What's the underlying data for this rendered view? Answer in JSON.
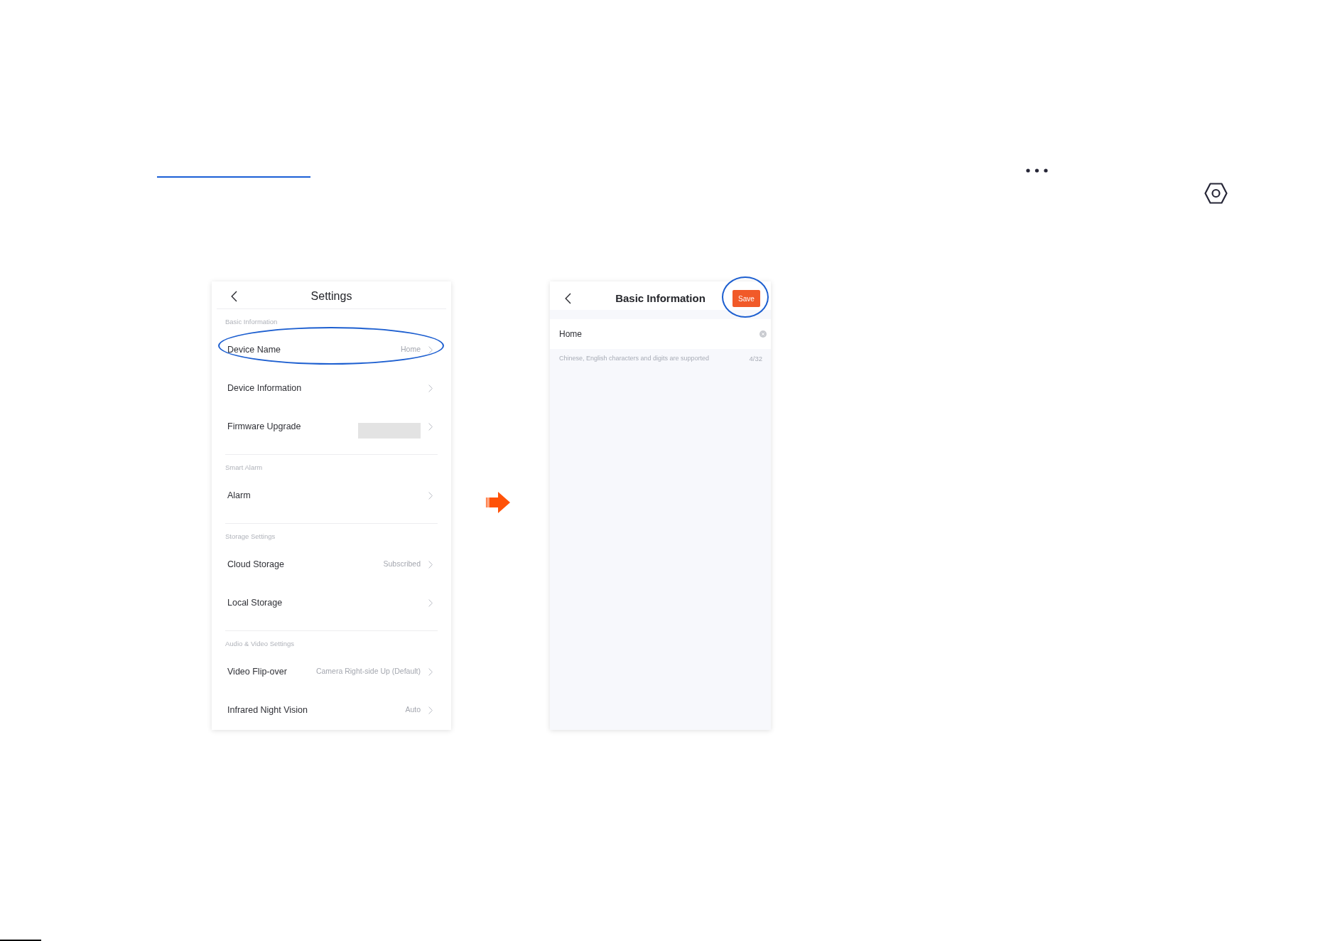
{
  "settings_screen": {
    "title": "Settings",
    "sections": [
      {
        "label": "Basic Information",
        "items": [
          {
            "label": "Device Name",
            "kind": "value",
            "value": "Home",
            "circled": true
          },
          {
            "label": "Device Information",
            "kind": "plain",
            "circled": false
          },
          {
            "label": "Firmware Upgrade",
            "kind": "masked",
            "circled": false
          }
        ]
      },
      {
        "label": "Smart Alarm",
        "items": [
          {
            "label": "Alarm",
            "kind": "plain",
            "circled": false
          }
        ]
      },
      {
        "label": "Storage Settings",
        "items": [
          {
            "label": "Cloud Storage",
            "kind": "value",
            "value": "Subscribed",
            "circled": false
          },
          {
            "label": "Local Storage",
            "kind": "plain",
            "circled": false
          }
        ]
      },
      {
        "label": "Audio & Video Settings",
        "items": [
          {
            "label": "Video Flip-over",
            "kind": "value",
            "value": "Camera Right-side Up (Default)",
            "circled": false
          },
          {
            "label": "Infrared Night Vision",
            "kind": "value",
            "value": "Auto",
            "circled": false
          }
        ]
      }
    ]
  },
  "basic_information_screen": {
    "title": "Basic Information",
    "save_button": {
      "label": "Save",
      "circled": true
    },
    "name_field": {
      "value": "Home"
    },
    "hint": "Chinese, English characters and digits are supported",
    "counter": "4/32"
  }
}
